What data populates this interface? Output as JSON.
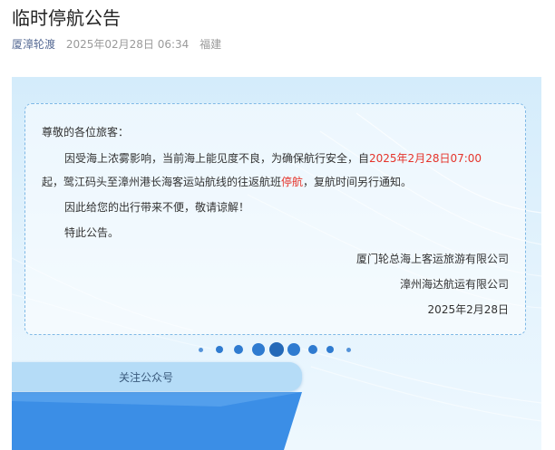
{
  "article": {
    "title": "临时停航公告",
    "account": "厦漳轮渡",
    "datetime": "2025年02月28日 06:34",
    "location": "福建"
  },
  "notice": {
    "greeting": "尊敬的各位旅客：",
    "para1_part1": "因受海上浓雾影响，当前海上能见度不良，为确保航行安全，自",
    "para1_highlight": "2025年2月28日07:00",
    "para1_part2": "起，鹭江码头至漳州港长海客运站航线的往返航班",
    "para1_highlight2": "停航",
    "para1_part3": "，复航时间另行通知。",
    "para2": "因此给您的出行带来不便，敬请谅解！",
    "para3": "特此公告。",
    "signer1": "厦门轮总海上客运旅游有限公司",
    "signer2": "漳州海达航运有限公司",
    "sign_date": "2025年2月28日"
  },
  "footer": {
    "follow_label": "关注公众号"
  },
  "colors": {
    "highlight": "#e5342b",
    "accent": "#2f7bd0",
    "account": "#576b95"
  }
}
